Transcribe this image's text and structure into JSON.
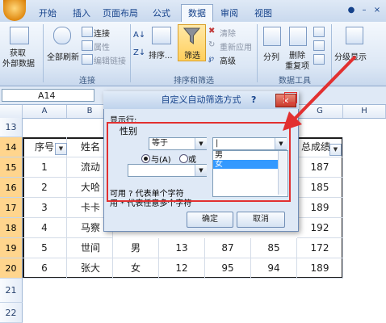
{
  "ribbon": {
    "tabs": [
      {
        "label": "开始"
      },
      {
        "label": "插入"
      },
      {
        "label": "页面布局"
      },
      {
        "label": "公式"
      },
      {
        "label": "数据"
      },
      {
        "label": "审阅"
      },
      {
        "label": "视图"
      }
    ],
    "active_tab": "数据",
    "groups": {
      "get_external": {
        "label": "获取\n外部数据",
        "l1": "获取",
        "l2": "外部数据"
      },
      "connections": {
        "label": "连接",
        "refresh_label": "全部刷新",
        "items": [
          "连接",
          "属性",
          "编辑链接"
        ]
      },
      "sort_filter": {
        "label": "排序和筛选",
        "sort_label": "排序...",
        "filter_label": "筛选",
        "items": [
          "清除",
          "重新应用",
          "高级"
        ]
      },
      "data_tools": {
        "label": "数据工具",
        "split_label": "分列",
        "remove_dup_l1": "删除",
        "remove_dup_l2": "重复项"
      },
      "outline": {
        "label": "分级显示"
      }
    }
  },
  "formula_bar": {
    "name_box": "A14"
  },
  "sheet": {
    "columns": [
      "A",
      "B",
      "C",
      "D",
      "E",
      "F",
      "G",
      "H"
    ],
    "rows": [
      "13",
      "14",
      "15",
      "16",
      "17",
      "18",
      "19",
      "20",
      "21",
      "22"
    ],
    "header_row": {
      "seq": "序号",
      "name": "姓名",
      "total": "总成绩"
    },
    "data": [
      {
        "seq": "1",
        "name": "流动",
        "total": "187"
      },
      {
        "seq": "2",
        "name": "大哈",
        "total": "185"
      },
      {
        "seq": "3",
        "name": "卡卡",
        "total": "189"
      },
      {
        "seq": "4",
        "name": "马察",
        "total": "192"
      },
      {
        "seq": "5",
        "name": "世间",
        "gender": "男",
        "d": "13",
        "e": "87",
        "f": "85",
        "total": "172"
      },
      {
        "seq": "6",
        "name": "张大",
        "gender": "女",
        "d": "12",
        "e": "95",
        "f": "94",
        "total": "189"
      }
    ]
  },
  "dialog": {
    "title": "自定义自动筛选方式",
    "help": "?",
    "close": "×",
    "show_rows_label": "显示行:",
    "field_label": "性别",
    "operator1": "等于",
    "value1": "|",
    "and_label": "与(A)",
    "or_label": "或",
    "hint1": "可用 ? 代表单个字符",
    "hint2": "用 * 代表任意多个字符",
    "ok": "确定",
    "cancel": "取消",
    "dropdown_options": [
      "男",
      "女"
    ]
  },
  "colors": {
    "accent": "#15428b",
    "annotation": "#e23030",
    "filter_highlight": "#ffcf5c"
  }
}
